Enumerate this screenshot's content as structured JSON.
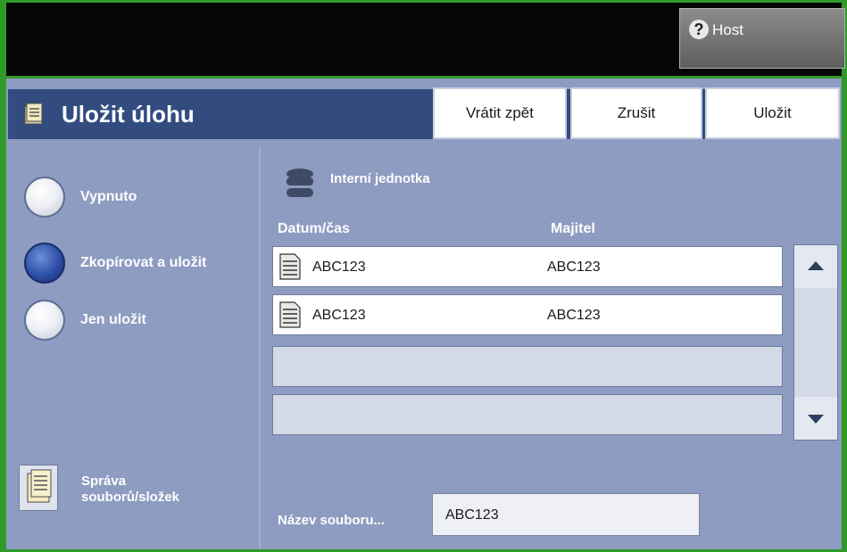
{
  "host": {
    "label": "Host",
    "icon": "help-icon"
  },
  "header": {
    "title": "Uložit úlohu",
    "buttons": {
      "undo": "Vrátit zpět",
      "cancel": "Zrušit",
      "save": "Uložit"
    }
  },
  "options": [
    {
      "label": "Vypnuto",
      "selected": false
    },
    {
      "label": "Zkopírovat a uložit",
      "selected": true
    },
    {
      "label": "Jen uložit",
      "selected": false
    }
  ],
  "storage": {
    "label": "Interní jednotka",
    "icon": "database-icon"
  },
  "columns": {
    "datetime": "Datum/čas",
    "owner": "Majitel"
  },
  "rows": [
    {
      "datetime": "ABC123",
      "owner": "ABC123"
    },
    {
      "datetime": "ABC123",
      "owner": "ABC123"
    },
    {
      "datetime": "",
      "owner": ""
    },
    {
      "datetime": "",
      "owner": ""
    }
  ],
  "file_management": {
    "line1": "Správa",
    "line2": "souborů/složek"
  },
  "filename": {
    "label": "Název souboru...",
    "value": "ABC123"
  },
  "colors": {
    "frame": "#2f9a2a",
    "title_bar": "#324c80",
    "panel": "#8d9cc0",
    "top_bar": "#050505"
  }
}
